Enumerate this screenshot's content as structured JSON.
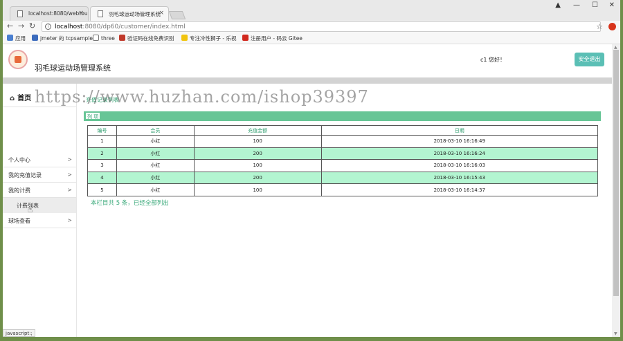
{
  "browser": {
    "tabs": [
      {
        "title": "localhost:8080/webtour",
        "active": false
      },
      {
        "title": "羽毛球运动场管理系统",
        "active": true
      }
    ],
    "url_host": "localhost",
    "url_path": ":8080/dp60/customer/index.html",
    "bookmarks": [
      {
        "label": "应用",
        "icon": "apps-icon"
      },
      {
        "label": "jmeter 的 tcpsample",
        "icon": "shield-icon"
      },
      {
        "label": "three",
        "icon": "page-icon"
      },
      {
        "label": "验证码在线免费识别",
        "icon": "red-icon"
      },
      {
        "label": "专注冷性狮子 - 乐视",
        "icon": "lion-icon"
      },
      {
        "label": "注册用户 - 码云 Gitee",
        "icon": "gitee-icon"
      }
    ],
    "status_text": "javascript:;"
  },
  "header": {
    "site_title": "羽毛球运动场管理系统",
    "greeting": "c1 您好！",
    "logout_label": "安全退出"
  },
  "sidebar": {
    "home_label": "首页",
    "items": [
      {
        "label": "个人中心",
        "chevron": ">"
      },
      {
        "label": "我的充值记录",
        "chevron": ">"
      },
      {
        "label": "我的计费",
        "chevron": ">"
      },
      {
        "label": "计费列表",
        "sub": true
      },
      {
        "label": "球场查看",
        "chevron": ">"
      }
    ]
  },
  "content": {
    "breadcrumb": "充值记录列表",
    "section_label": "列 项",
    "table": {
      "columns": [
        "编号",
        "会员",
        "充值金额",
        "日期"
      ],
      "rows": [
        [
          "1",
          "小红",
          "100",
          "2018-03-10 16:16:49"
        ],
        [
          "2",
          "小红",
          "200",
          "2018-03-10 16:16:24"
        ],
        [
          "3",
          "小红",
          "100",
          "2018-03-10 16:16:03"
        ],
        [
          "4",
          "小红",
          "200",
          "2018-03-10 16:15:43"
        ],
        [
          "5",
          "小红",
          "100",
          "2018-03-10 16:14:37"
        ]
      ]
    },
    "summary": "本栏目共 5 条，已经全部列出"
  },
  "watermark": "https://www.huzhan.com/ishop39397",
  "colors": {
    "accent_green": "#67c596",
    "row_highlight": "#b3f5d1",
    "logout_bg": "#5bbfb5"
  }
}
